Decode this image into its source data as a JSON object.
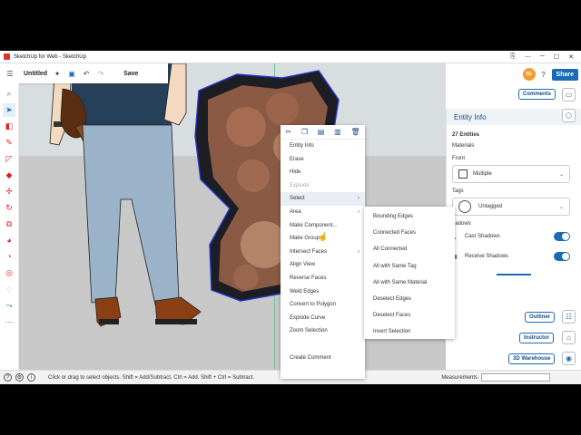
{
  "window": {
    "title": "SketchUp for Web - SketchUp",
    "controls": [
      "⎘",
      "⋯",
      "─",
      "☐",
      "✕"
    ]
  },
  "toolbar": {
    "doc_name": "Untitled",
    "save_label": "Save",
    "icons": [
      "menu-icon",
      "sparkle-icon",
      "view-icon",
      "undo-icon",
      "redo-icon"
    ]
  },
  "header_right": {
    "avatar_text": "SE",
    "share_label": "Share",
    "comments_label": "Comments"
  },
  "left_tools": [
    "select",
    "eraser",
    "pencil",
    "rectangle",
    "pushpull",
    "move",
    "rotate",
    "scale",
    "paint",
    "tape",
    "offset",
    "section",
    "orbit",
    "walk",
    "more"
  ],
  "entity_info": {
    "title": "Entity Info",
    "count": "27 Entities",
    "materials_label": "Materials",
    "front_label": "Front",
    "material_value": "Multiple",
    "tags_label": "Tags",
    "tag_value": "Untagged",
    "shadows_label": "hadows",
    "cast_shadows": "Cast Shadows",
    "receive_shadows": "Receive Shadows"
  },
  "side_pills": {
    "outliner": "Outliner",
    "instructor": "Instructor",
    "warehouse": "3D Warehouse"
  },
  "context_menu": {
    "items": [
      {
        "label": "Entity Info",
        "disabled": false,
        "submenu": false
      },
      {
        "label": "Erase",
        "disabled": false,
        "submenu": false
      },
      {
        "label": "Hide",
        "disabled": false,
        "submenu": false
      },
      {
        "label": "Explode",
        "disabled": true,
        "submenu": false
      },
      {
        "label": "Select",
        "disabled": false,
        "submenu": true
      },
      {
        "label": "Area",
        "disabled": false,
        "submenu": true
      },
      {
        "label": "Make Component...",
        "disabled": false,
        "submenu": false
      },
      {
        "label": "Make Group",
        "disabled": false,
        "submenu": false
      },
      {
        "label": "Intersect Faces",
        "disabled": false,
        "submenu": true
      },
      {
        "label": "Align View",
        "disabled": false,
        "submenu": false
      },
      {
        "label": "Reverse Faces",
        "disabled": false,
        "submenu": false
      },
      {
        "label": "Weld Edges",
        "disabled": false,
        "submenu": false
      },
      {
        "label": "Convert to Polygon",
        "disabled": false,
        "submenu": false
      },
      {
        "label": "Explode Curve",
        "disabled": false,
        "submenu": false
      },
      {
        "label": "Zoom Selection",
        "disabled": false,
        "submenu": false
      },
      {
        "label": "",
        "disabled": false,
        "submenu": false
      },
      {
        "label": "Create Comment",
        "disabled": false,
        "submenu": false
      }
    ]
  },
  "select_submenu": {
    "items": [
      "Bounding Edges",
      "Connected Faces",
      "All Connected",
      "All with Same Tag",
      "All with Same Material",
      "Deselect Edges",
      "Deselect Faces",
      "Invert Selection"
    ]
  },
  "status": {
    "hint": "Click or drag to select objects. Shift = Add/Subtract. Ctrl = Add. Shift + Ctrl = Subtract.",
    "measurements_label": "Measurements"
  },
  "colors": {
    "accent": "#1a6bb5",
    "avatar": "#f39c36",
    "selection_outline": "#2233cc"
  }
}
